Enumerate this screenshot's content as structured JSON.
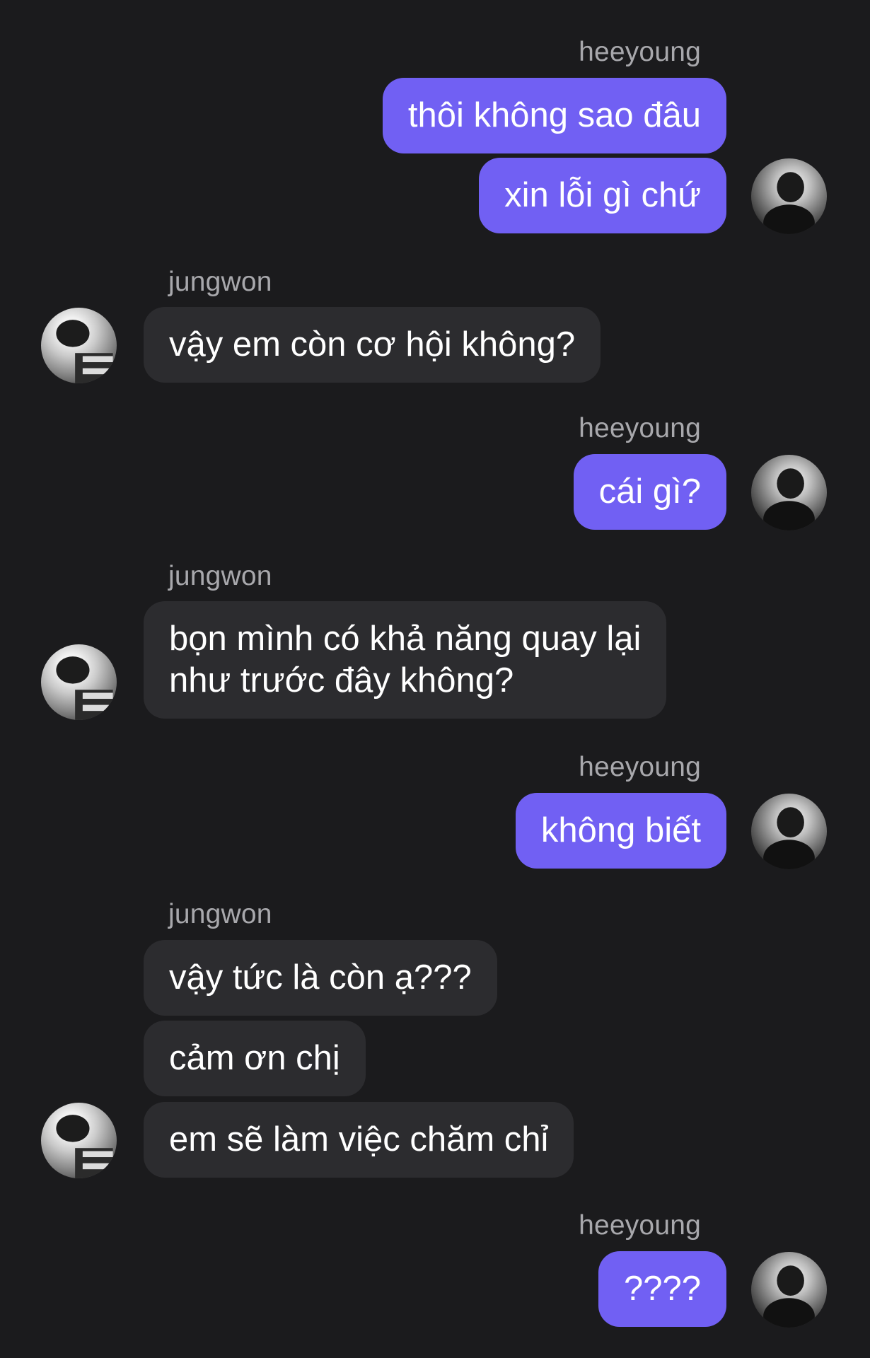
{
  "chat": {
    "messages": [
      {
        "sender": "heeyoung",
        "lines": [
          "thôi không sao đâu"
        ]
      },
      {
        "sender": "heeyoung",
        "lines": [
          "xin lỗi gì chứ"
        ]
      },
      {
        "sender": "jungwon",
        "lines": [
          "vậy em còn cơ hội không?"
        ]
      },
      {
        "sender": "heeyoung",
        "lines": [
          "cái gì?"
        ]
      },
      {
        "sender": "jungwon",
        "lines": [
          "bọn mình có khả năng quay lại",
          "như trước đây không?"
        ]
      },
      {
        "sender": "heeyoung",
        "lines": [
          "không biết"
        ]
      },
      {
        "sender": "jungwon",
        "lines": [
          "vậy tức là còn ạ???"
        ]
      },
      {
        "sender": "jungwon",
        "lines": [
          "cảm ơn chị"
        ]
      },
      {
        "sender": "jungwon",
        "lines": [
          "em sẽ làm việc chăm chỉ"
        ]
      },
      {
        "sender": "heeyoung",
        "lines": [
          "????"
        ]
      }
    ]
  },
  "colors": {
    "background": "#1b1b1d",
    "outgoing_bubble": "#7160f3",
    "incoming_bubble": "#2c2c2f",
    "sender_name": "#a8a8ac"
  },
  "icons": {
    "heeyoung_avatar": "user-photo-avatar",
    "jungwon_avatar": "user-photo-avatar"
  }
}
